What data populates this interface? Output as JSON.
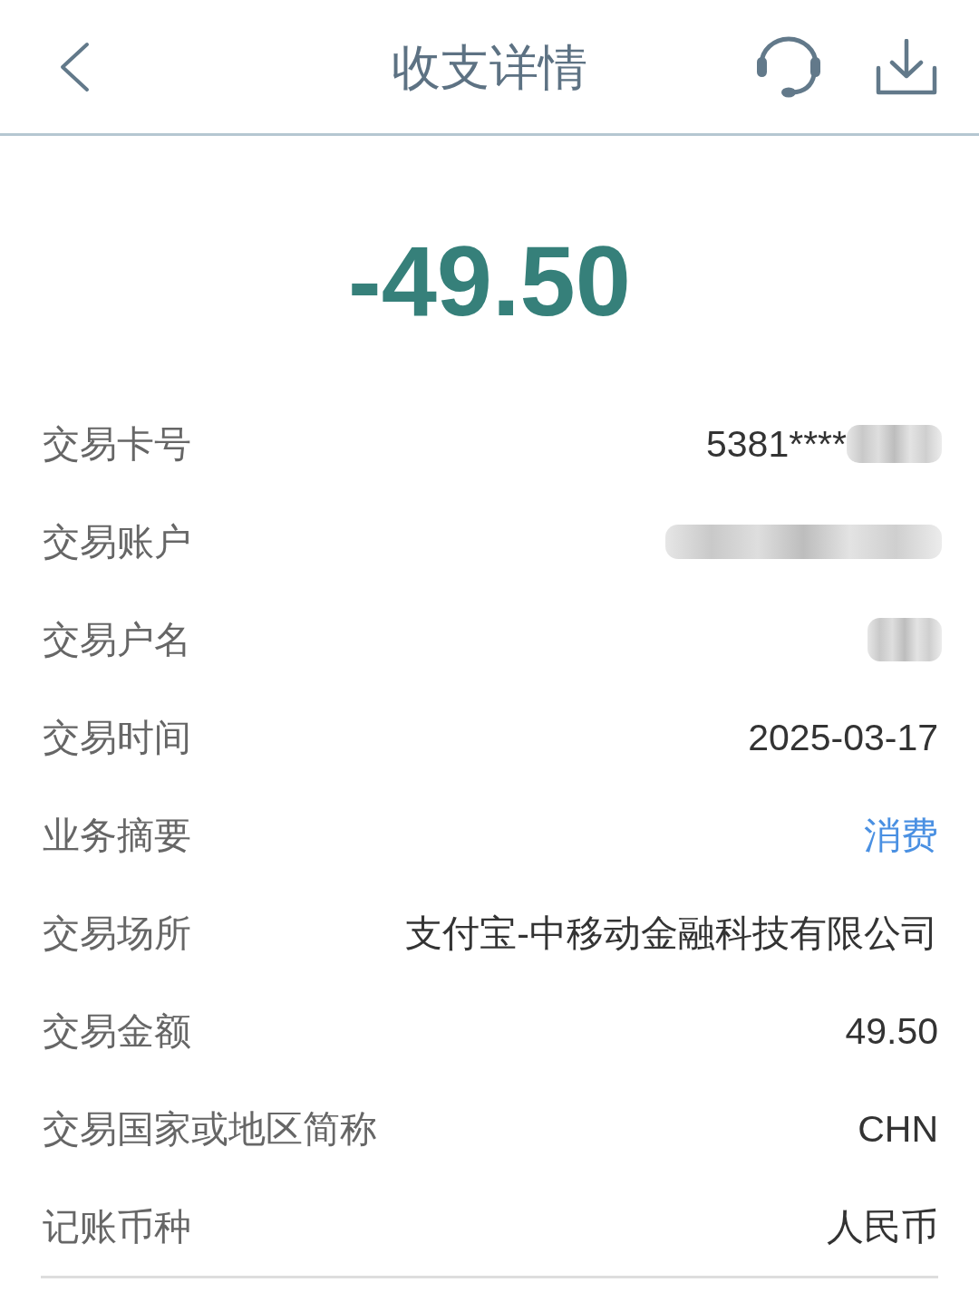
{
  "header": {
    "title": "收支详情"
  },
  "amount": "-49.50",
  "rows": [
    {
      "label": "交易卡号",
      "value": "5381****",
      "redacted": true,
      "link": false
    },
    {
      "label": "交易账户",
      "redacted": true
    },
    {
      "label": "交易户名",
      "redacted": true
    },
    {
      "label": "交易时间",
      "value": "2025-03-17",
      "redacted": false,
      "link": false
    },
    {
      "label": "业务摘要",
      "value": "消费",
      "redacted": false,
      "link": true
    },
    {
      "label": "交易场所",
      "value": "支付宝-中移动金融科技有限公司",
      "redacted": false,
      "link": false
    },
    {
      "label": "交易金额",
      "value": "49.50",
      "redacted": false,
      "link": false
    },
    {
      "label": "交易国家或地区简称",
      "value": "CHN",
      "redacted": false,
      "link": false
    },
    {
      "label": "记账币种",
      "value": "人民币",
      "redacted": false,
      "link": false
    }
  ]
}
